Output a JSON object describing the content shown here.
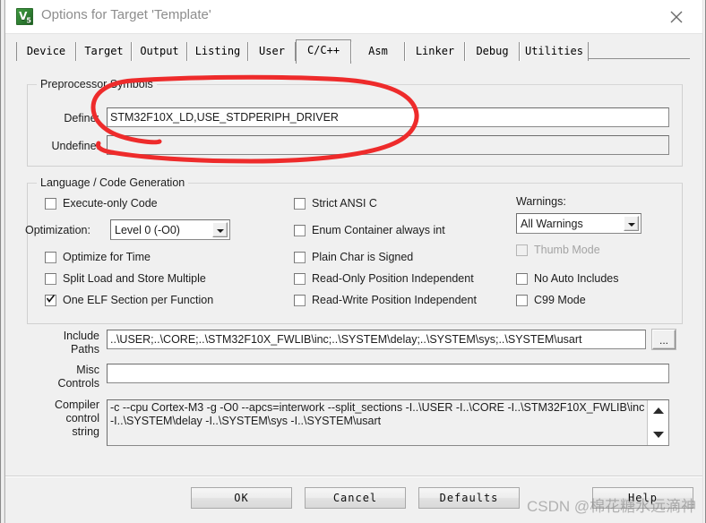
{
  "window": {
    "title": "Options for Target 'Template'",
    "icon_label": "V",
    "icon_sub": "5",
    "close_icon": "close-icon"
  },
  "tabs": [
    {
      "label": "Device",
      "selected": false
    },
    {
      "label": "Target",
      "selected": false
    },
    {
      "label": "Output",
      "selected": false
    },
    {
      "label": "Listing",
      "selected": false
    },
    {
      "label": "User",
      "selected": false
    },
    {
      "label": "C/C++",
      "selected": true
    },
    {
      "label": "Asm",
      "selected": false
    },
    {
      "label": "Linker",
      "selected": false
    },
    {
      "label": "Debug",
      "selected": false
    },
    {
      "label": "Utilities",
      "selected": false
    }
  ],
  "preprocessor": {
    "group_title": "Preprocessor Symbols",
    "define_label": "Define:",
    "define_value": "STM32F10X_LD,USE_STDPERIPH_DRIVER",
    "undefine_label": "Undefine:",
    "undefine_value": ""
  },
  "language": {
    "group_title": "Language / Code Generation",
    "left_checkboxes": [
      {
        "label": "Execute-only Code",
        "checked": false,
        "disabled": false
      },
      {
        "label": "Optimize for Time",
        "checked": false,
        "disabled": false
      },
      {
        "label": "Split Load and Store Multiple",
        "checked": false,
        "disabled": false
      },
      {
        "label": "One ELF Section per Function",
        "checked": true,
        "disabled": false
      }
    ],
    "optimization_label": "Optimization:",
    "optimization_value": "Level 0 (-O0)",
    "middle_checkboxes": [
      {
        "label": "Strict ANSI C",
        "checked": false,
        "disabled": false
      },
      {
        "label": "Enum Container always int",
        "checked": false,
        "disabled": false
      },
      {
        "label": "Plain Char is Signed",
        "checked": false,
        "disabled": false
      },
      {
        "label": "Read-Only Position Independent",
        "checked": false,
        "disabled": false
      },
      {
        "label": "Read-Write Position Independent",
        "checked": false,
        "disabled": false
      }
    ],
    "warnings_label": "Warnings:",
    "warnings_value": "All Warnings",
    "right_checkboxes": [
      {
        "label": "Thumb Mode",
        "checked": false,
        "disabled": true
      },
      {
        "label": "No Auto Includes",
        "checked": false,
        "disabled": false
      },
      {
        "label": "C99 Mode",
        "checked": false,
        "disabled": false
      }
    ]
  },
  "paths": {
    "include_label_line1": "Include",
    "include_label_line2": "Paths",
    "include_value": "..\\USER;..\\CORE;..\\STM32F10X_FWLIB\\inc;..\\SYSTEM\\delay;..\\SYSTEM\\sys;..\\SYSTEM\\usart",
    "browse_label": "...",
    "misc_label_line1": "Misc",
    "misc_label_line2": "Controls",
    "misc_value": "",
    "compiler_label_line1": "Compiler",
    "compiler_label_line2": "control",
    "compiler_label_line3": "string",
    "compiler_value": "-c --cpu Cortex-M3 -g -O0 --apcs=interwork --split_sections -I..\\USER -I..\\CORE -I..\\STM32F10X_FWLIB\\inc -I..\\SYSTEM\\delay -I..\\SYSTEM\\sys -I..\\SYSTEM\\usart"
  },
  "buttons": [
    {
      "label": "OK"
    },
    {
      "label": "Cancel"
    },
    {
      "label": "Defaults"
    },
    {
      "label": "Help"
    }
  ],
  "annotation": {
    "color": "#ee2b2b",
    "shape": "hand-drawn-ellipse"
  },
  "watermark": {
    "text": "CSDN @棉花糖水远滴神"
  }
}
